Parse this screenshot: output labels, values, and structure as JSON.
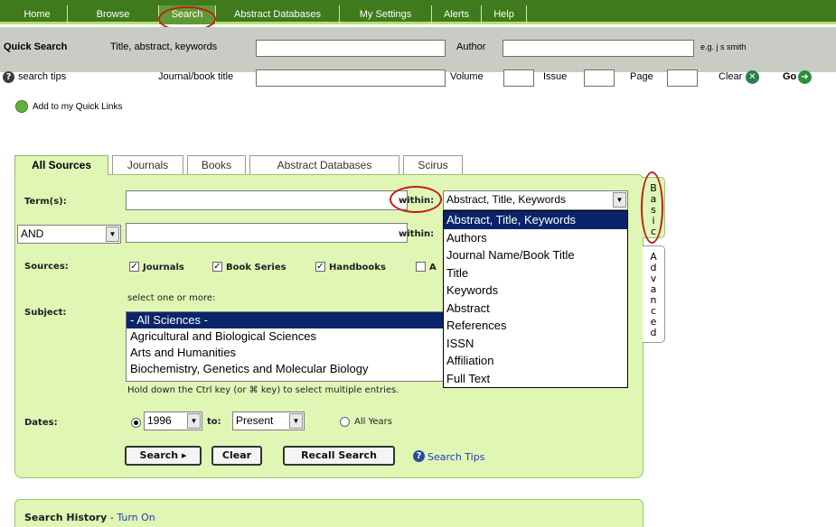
{
  "nav": {
    "items": [
      "Home",
      "Browse",
      "Search",
      "Abstract Databases",
      "My Settings",
      "Alerts",
      "Help"
    ]
  },
  "quick_search": {
    "title": "Quick Search",
    "tfa_label": "Title, abstract, keywords",
    "author_label": "Author",
    "author_hint": "e.g. j s smith",
    "search_tips": "search tips",
    "journal_label": "Journal/book title",
    "volume_label": "Volume",
    "issue_label": "Issue",
    "page_label": "Page",
    "clear_label": "Clear",
    "go_label": "Go"
  },
  "quick_links": "Add to my Quick Links",
  "tabs": [
    "All Sources",
    "Journals",
    "Books",
    "Abstract Databases",
    "Scirus"
  ],
  "form": {
    "terms_label": "Term(s):",
    "within_label": "within:",
    "within_value": "Abstract, Title, Keywords",
    "operator_value": "AND",
    "sources_label": "Sources:",
    "sources": [
      "Journals",
      "Book Series",
      "Handbooks"
    ],
    "sources_extra": "A",
    "select_hint": "select one or more:",
    "subject_label": "Subject:",
    "subjects": [
      "- All Sciences -",
      "Agricultural and Biological Sciences",
      "Arts and Humanities",
      "Biochemistry, Genetics and Molecular Biology"
    ],
    "ctrl_hint": "Hold down the Ctrl key (or ⌘ key) to select multiple entries.",
    "dates_label": "Dates:",
    "from_year": "1996",
    "to_label": "to:",
    "to_value": "Present",
    "all_years": "All Years",
    "search_btn": "Search ▸",
    "clear_btn": "Clear",
    "recall_btn": "Recall Search",
    "search_tips": "Search Tips"
  },
  "within_options": [
    "Abstract, Title, Keywords",
    "Authors",
    "Journal Name/Book Title",
    "Title",
    "Keywords",
    "Abstract",
    "References",
    "ISSN",
    "Affiliation",
    "Full Text"
  ],
  "side_tabs": {
    "basic": [
      "B",
      "a",
      "s",
      "i",
      "c"
    ],
    "advanced": [
      "A",
      "d",
      "v",
      "a",
      "n",
      "c",
      "e",
      "d"
    ]
  },
  "history": {
    "title": "Search History",
    "sep": " - ",
    "toggle": "Turn On"
  },
  "colors": {
    "nav_green": "#3f7a1c",
    "panel_green": "#e0f6b5",
    "highlight_red": "#c21c1c",
    "link_blue": "#1f3fb5"
  }
}
